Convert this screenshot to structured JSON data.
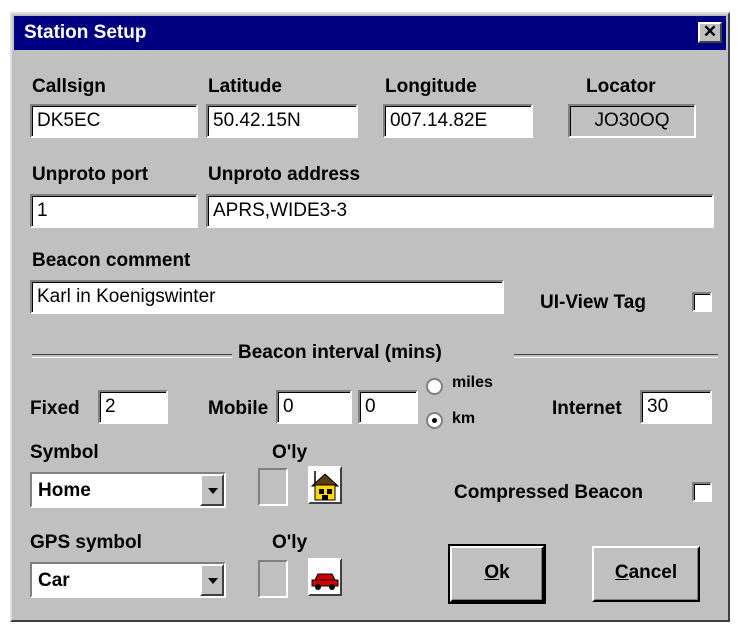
{
  "window": {
    "title": "Station Setup",
    "close_glyph": "✕"
  },
  "labels": {
    "callsign": "Callsign",
    "latitude": "Latitude",
    "longitude": "Longitude",
    "locator": "Locator",
    "unproto_port": "Unproto port",
    "unproto_address": "Unproto address",
    "beacon_comment": "Beacon comment",
    "ui_view_tag": "UI-View Tag",
    "beacon_interval": "Beacon interval (mins)",
    "fixed": "Fixed",
    "mobile": "Mobile",
    "internet": "Internet",
    "miles": "miles",
    "km": "km",
    "symbol": "Symbol",
    "overlay1": "O'ly",
    "gps_symbol": "GPS symbol",
    "overlay2": "O'ly",
    "compressed_beacon": "Compressed Beacon"
  },
  "values": {
    "callsign": "DK5EC",
    "latitude": "50.42.15N",
    "longitude": "007.14.82E",
    "locator": "JO30OQ",
    "unproto_port": "1",
    "unproto_address": "APRS,WIDE3-3",
    "beacon_comment": "Karl in Koenigswinter",
    "fixed": "2",
    "mobile1": "0",
    "mobile2": "0",
    "internet": "30",
    "symbol": "Home",
    "gps_symbol": "Car",
    "ui_view_tag_checked": false,
    "compressed_beacon_checked": false,
    "distance_unit": "km"
  },
  "buttons": {
    "ok_mnemonic": "O",
    "ok_rest": "k",
    "cancel_mnemonic": "C",
    "cancel_rest": "ancel"
  },
  "icons": {
    "symbol_icon": "house-icon",
    "gps_icon": "car-icon"
  },
  "colors": {
    "titlebar": "#000080",
    "dialog": "#c0c0c0"
  }
}
